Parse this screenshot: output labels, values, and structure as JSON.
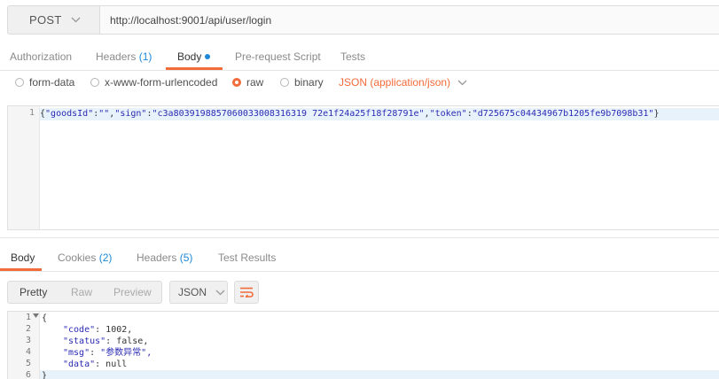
{
  "request": {
    "method": "POST",
    "url": "http://localhost:9001/api/user/login"
  },
  "request_tabs": [
    {
      "label": "Authorization"
    },
    {
      "label": "Headers",
      "count": "(1)"
    },
    {
      "label": "Body"
    },
    {
      "label": "Pre-request Script"
    },
    {
      "label": "Tests"
    }
  ],
  "body_types": [
    "form-data",
    "x-www-form-urlencoded",
    "raw",
    "binary"
  ],
  "body_type_selected": "raw",
  "content_type": "JSON (application/json)",
  "request_body": {
    "line_number": "1",
    "parts": [
      "{",
      "\"goodsId\"",
      ":",
      "\"\"",
      ",",
      "\"sign\"",
      ":",
      "\"c3a8039198857060033008316319 72e1f24a25f18f28791e\"",
      ",",
      "\"token\"",
      ":",
      "\"d725675c04434967b1205fe9b7098b31\"",
      "}"
    ]
  },
  "response_tabs": [
    {
      "label": "Body"
    },
    {
      "label": "Cookies",
      "count": "(2)"
    },
    {
      "label": "Headers",
      "count": "(5)"
    },
    {
      "label": "Test Results"
    }
  ],
  "view_modes": [
    "Pretty",
    "Raw",
    "Preview"
  ],
  "format": "JSON",
  "response_body": {
    "lines": [
      {
        "n": "1",
        "text": "{"
      },
      {
        "n": "2",
        "key": "\"code\"",
        "value": "1002,"
      },
      {
        "n": "3",
        "key": "\"status\"",
        "value": "false,"
      },
      {
        "n": "4",
        "key": "\"msg\"",
        "value": "\"参数异常\","
      },
      {
        "n": "5",
        "key": "\"data\"",
        "value": "null"
      },
      {
        "n": "6",
        "text": "}"
      }
    ]
  },
  "colors": {
    "accent": "#f26b3a",
    "link": "#1e88d8"
  }
}
